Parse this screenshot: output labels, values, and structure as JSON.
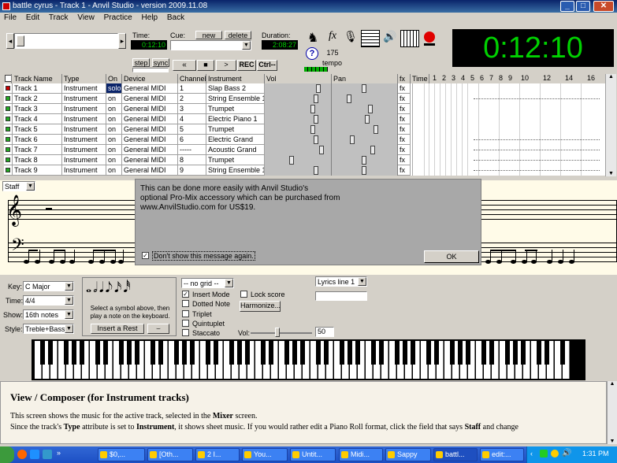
{
  "window": {
    "title": "battle cyrus - Track 1 - Anvil Studio - version 2009.11.08"
  },
  "menu": [
    "File",
    "Edit",
    "Track",
    "View",
    "Practice",
    "Help",
    "Back"
  ],
  "transport": {
    "time_label": "Time:",
    "time_value": "0:12:10",
    "cue_label": "Cue:",
    "new_label": "new",
    "delete_label": "delete",
    "duration_label": "Duration:",
    "duration_value": "2:08:27",
    "step_label": "step",
    "sync_label": "sync",
    "rewind": "«",
    "stop": "■",
    "play": ">",
    "rec": "REC",
    "ctrl": "Ctrl--",
    "tempo_value": "175",
    "tempo_label": "tempo",
    "help_mark": "?"
  },
  "big_clock": "0:12:10",
  "track_headers": [
    "Track Name",
    "Type",
    "On",
    "Device",
    "Channel",
    "Instrument",
    "Vol",
    "Pan",
    "fx",
    "Time"
  ],
  "measure_numbers": [
    "1",
    "2",
    "3",
    "4",
    "5",
    "6",
    "7",
    "8",
    "9",
    "10",
    "12",
    "14",
    "16"
  ],
  "tracks": [
    {
      "name": "Track 1",
      "type": "Instrument",
      "on": "solo",
      "device": "General MIDI",
      "channel": "1",
      "instrument": "Slap Bass 2",
      "fx": "fx",
      "vol": 0.85,
      "pan": 0.5
    },
    {
      "name": "Track 2",
      "type": "Instrument",
      "on": "on",
      "device": "General MIDI",
      "channel": "2",
      "instrument": "String Ensemble 1",
      "fx": "fx",
      "vol": 0.8,
      "pan": 0.25
    },
    {
      "name": "Track 3",
      "type": "Instrument",
      "on": "on",
      "device": "General MIDI",
      "channel": "3",
      "instrument": "Trumpet",
      "fx": "fx",
      "vol": 0.75,
      "pan": 0.6
    },
    {
      "name": "Track 4",
      "type": "Instrument",
      "on": "on",
      "device": "General MIDI",
      "channel": "4",
      "instrument": "Electric Piano 1",
      "fx": "fx",
      "vol": 0.8,
      "pan": 0.55
    },
    {
      "name": "Track 5",
      "type": "Instrument",
      "on": "on",
      "device": "General MIDI",
      "channel": "5",
      "instrument": "Trumpet",
      "fx": "fx",
      "vol": 0.75,
      "pan": 0.7
    },
    {
      "name": "Track 6",
      "type": "Instrument",
      "on": "on",
      "device": "General MIDI",
      "channel": "6",
      "instrument": "Electric Grand",
      "fx": "fx",
      "vol": 0.8,
      "pan": 0.3
    },
    {
      "name": "Track 7",
      "type": "Instrument",
      "on": "on",
      "device": "General MIDI",
      "channel": "-----",
      "instrument": "Acoustic Grand",
      "fx": "fx",
      "vol": 0.9,
      "pan": 0.65
    },
    {
      "name": "Track 8",
      "type": "Instrument",
      "on": "on",
      "device": "General MIDI",
      "channel": "8",
      "instrument": "Trumpet",
      "fx": "fx",
      "vol": 0.4,
      "pan": 0.5
    },
    {
      "name": "Track 9",
      "type": "Instrument",
      "on": "on",
      "device": "General MIDI",
      "channel": "9",
      "instrument": "String Ensemble 1",
      "fx": "fx",
      "vol": 0.8,
      "pan": 0.5
    }
  ],
  "staff_view_label": "Staff",
  "dialog": {
    "message": "This can be done more easily with Anvil Studio's\noptional Pro-Mix accessory which can be purchased from\nwww.AnvilStudio.com for US$19.",
    "checkbox_label": "Don't show this message again.",
    "ok_label": "OK"
  },
  "composer": {
    "key_label": "Key:",
    "key_value": "C Major",
    "time_label": "Time:",
    "time_value": "4/4",
    "show_label": "Show:",
    "show_value": "16th notes",
    "style_label": "Style:",
    "style_value": "Treble+Bass",
    "symbol_hint": "Select a symbol above, then play a note on the keyboard.",
    "insert_rest_label": "Insert a Rest",
    "grid_value": "-- no grid --",
    "insert_mode_label": "Insert Mode",
    "lock_score_label": "Lock score",
    "dotted_note_label": "Dotted Note",
    "harmonize_label": "Harmonize...",
    "triplet_label": "Triplet",
    "quintuplet_label": "Quintuplet",
    "staccato_label": "Staccato",
    "vol_label": "Vol:",
    "vol_value": "50",
    "lyrics_value": "Lyrics line 1"
  },
  "help": {
    "heading": "View / Composer (for Instrument tracks)",
    "p1_a": "This screen shows the music for the active track, selected in the ",
    "p1_b": "Mixer",
    "p1_c": " screen.",
    "p2_a": "Since the track's ",
    "p2_b": "Type",
    "p2_c": " attribute is set to ",
    "p2_d": "Instrument",
    "p2_e": ", it shows sheet music. If you would rather edit a Piano Roll format, click the field that says ",
    "p2_f": "Staff",
    "p2_g": " and change"
  },
  "taskbar": {
    "items": [
      "$0,...",
      "[Oth...",
      "2 I...",
      "You...",
      "Untit...",
      "Midi...",
      "Sappy",
      "battl...",
      "edit:..."
    ],
    "clock": "1:31 PM"
  }
}
